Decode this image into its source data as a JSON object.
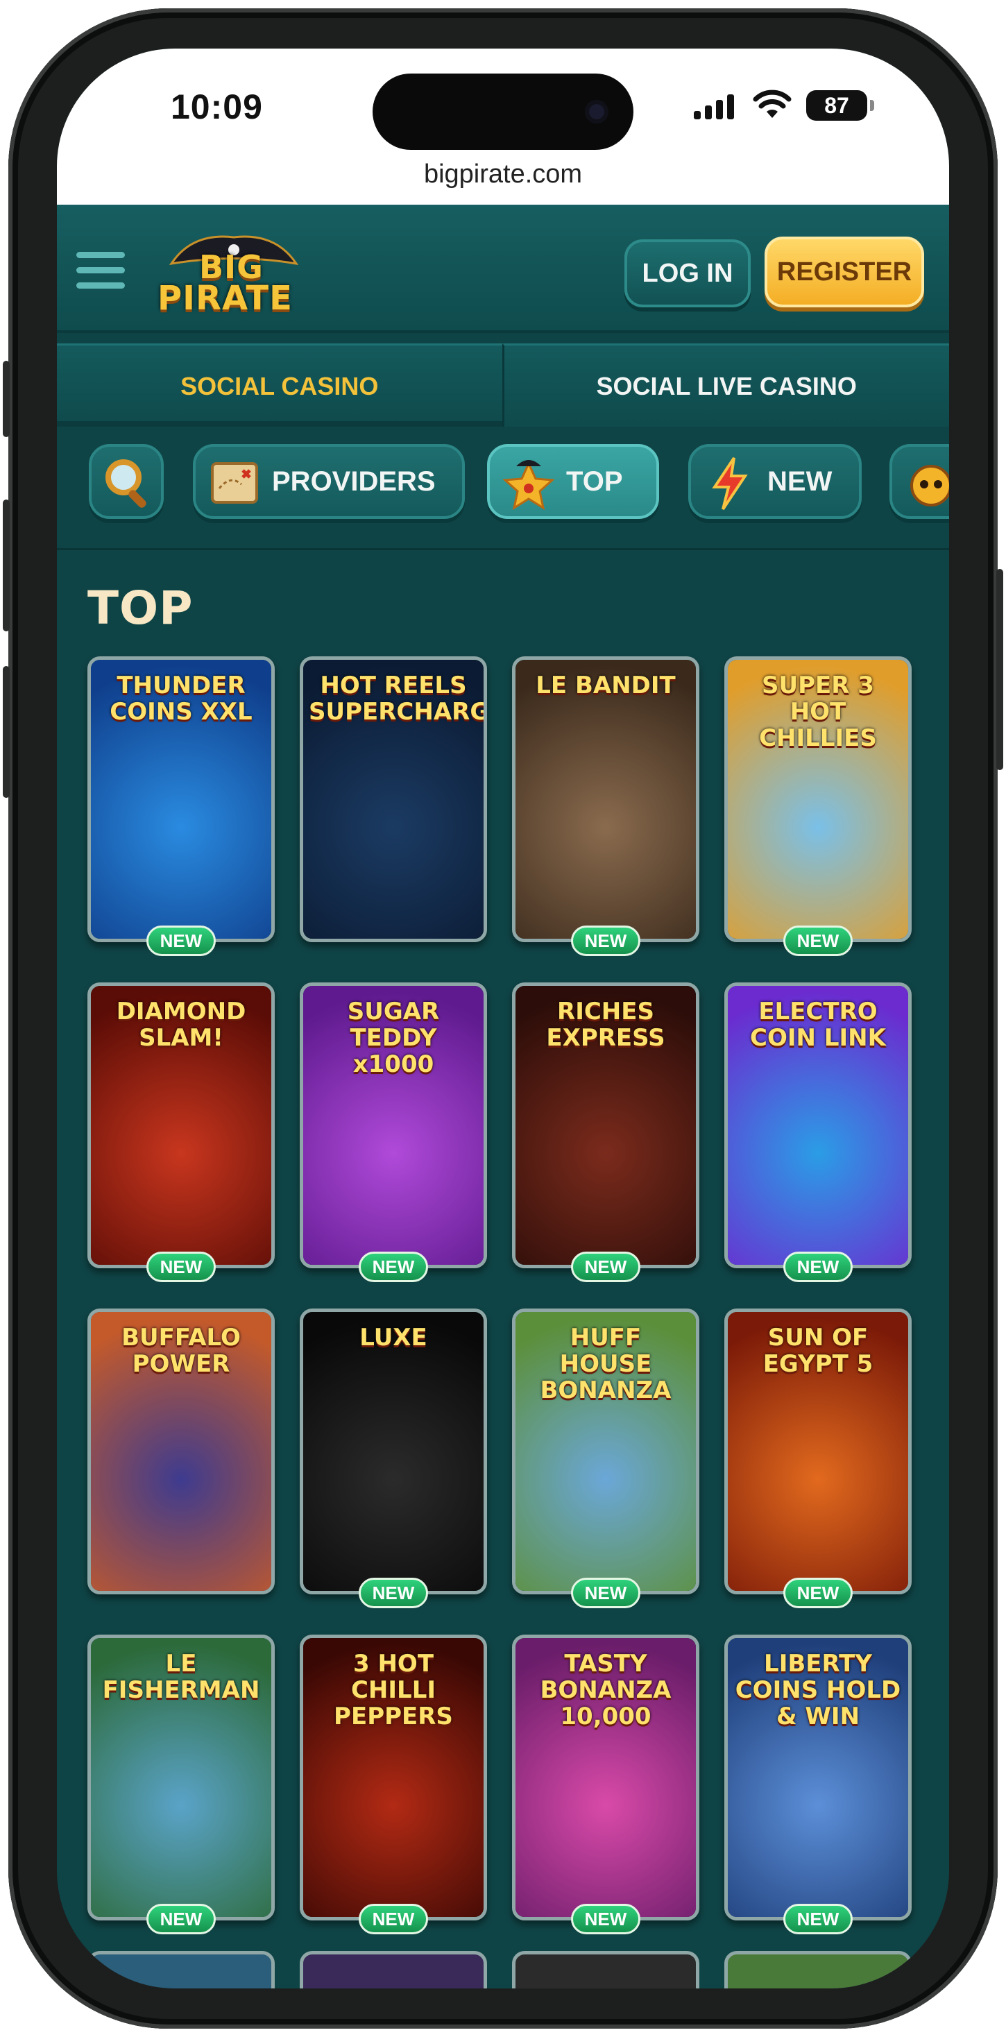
{
  "status_bar": {
    "time": "10:09",
    "battery": "87",
    "url": "bigpirate.com"
  },
  "header": {
    "logo_line1": "BIG",
    "logo_line2": "PIRATE",
    "login_label": "LOG IN",
    "register_label": "REGISTER"
  },
  "category_tabs": [
    {
      "label": "SOCIAL CASINO",
      "active": true
    },
    {
      "label": "SOCIAL LIVE CASINO",
      "active": false
    }
  ],
  "filters": [
    {
      "label": "",
      "icon": "magnifier-icon"
    },
    {
      "label": "PROVIDERS",
      "icon": "treasure-map-icon"
    },
    {
      "label": "TOP",
      "icon": "pirate-star-icon",
      "active": true
    },
    {
      "label": "NEW",
      "icon": "lightning-icon"
    },
    {
      "label": "",
      "icon": "skull-icon"
    }
  ],
  "section_title": "TOP",
  "badge_label": "NEW",
  "games": [
    {
      "name": "THUNDER COINS XXL",
      "badge": "NEW",
      "bg": [
        "#2a8be0",
        "#0f3f8c"
      ]
    },
    {
      "name": "HOT REELS SUPERCHARGED",
      "badge": "",
      "bg": [
        "#1b3b63",
        "#0b1b33"
      ]
    },
    {
      "name": "LE BANDIT",
      "badge": "NEW",
      "bg": [
        "#8a6b4e",
        "#3b2a1c"
      ]
    },
    {
      "name": "SUPER 3 HOT CHILLIES",
      "badge": "NEW",
      "bg": [
        "#7ac0e8",
        "#e19d2a"
      ]
    },
    {
      "name": "DIAMOND SLAM!",
      "badge": "NEW",
      "bg": [
        "#c8361e",
        "#5a0c06"
      ]
    },
    {
      "name": "SUGAR TEDDY x1000",
      "badge": "NEW",
      "bg": [
        "#b04ad9",
        "#5e1a8e"
      ]
    },
    {
      "name": "RICHES EXPRESS",
      "badge": "NEW",
      "bg": [
        "#7b2b1c",
        "#2c0d09"
      ]
    },
    {
      "name": "ELECTRO COIN LINK",
      "badge": "NEW",
      "bg": [
        "#2b9de6",
        "#6b2bcf"
      ]
    },
    {
      "name": "BUFFALO POWER",
      "badge": "",
      "bg": [
        "#3e3b8f",
        "#c45a2a"
      ]
    },
    {
      "name": "LUXE",
      "badge": "NEW",
      "bg": [
        "#2b2b2b",
        "#090909"
      ]
    },
    {
      "name": "HUFF HOUSE BONANZA",
      "badge": "NEW",
      "bg": [
        "#6ba7d8",
        "#5c8f3a"
      ]
    },
    {
      "name": "SUN OF EGYPT 5",
      "badge": "NEW",
      "bg": [
        "#e26a1e",
        "#7b1a08"
      ]
    },
    {
      "name": "LE FISHERMAN",
      "badge": "NEW",
      "bg": [
        "#5aa3c8",
        "#2c6a3a"
      ]
    },
    {
      "name": "3 HOT CHILLI PEPPERS",
      "badge": "NEW",
      "bg": [
        "#b22a14",
        "#3a0804"
      ]
    },
    {
      "name": "TASTY BONANZA 10,000",
      "badge": "NEW",
      "bg": [
        "#d94aa8",
        "#6a1d6a"
      ]
    },
    {
      "name": "LIBERTY COINS HOLD & WIN",
      "badge": "NEW",
      "bg": [
        "#5c8fd8",
        "#1f3f7a"
      ]
    }
  ],
  "colors": {
    "background": "#0f4446",
    "accent_gold": "#f3c23a",
    "badge_green": "#1fae60"
  }
}
